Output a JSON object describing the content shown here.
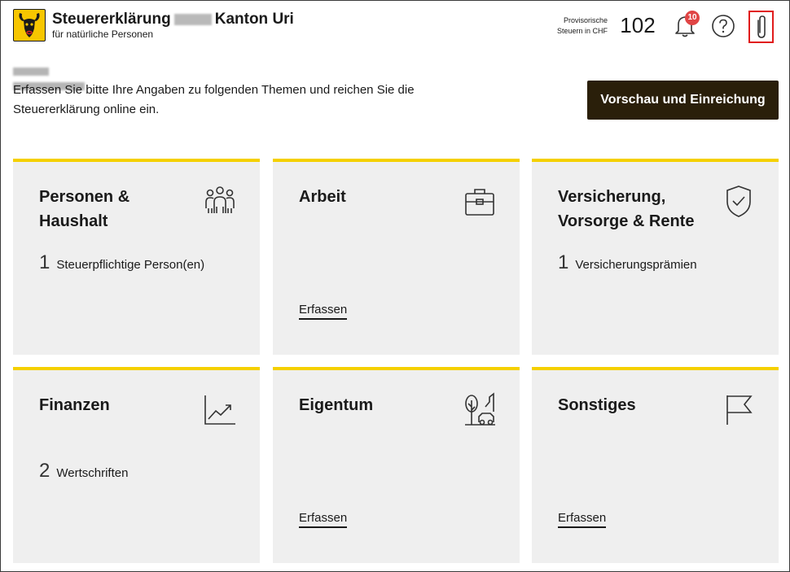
{
  "header": {
    "title_part1": "Steuererklärung",
    "title_part2": "Kanton Uri",
    "subtitle": "für natürliche Personen",
    "tax_label_line1": "Provisorische",
    "tax_label_line2": "Steuern in CHF",
    "tax_amount": "102",
    "notification_count": "10"
  },
  "intro": {
    "text": "Erfassen Sie bitte Ihre Angaben zu folgenden Themen und reichen Sie die Steuererklärung online ein.",
    "submit_label": "Vorschau und Einreichung"
  },
  "cards": [
    {
      "title": "Personen & Haushalt",
      "count": "1",
      "count_label": "Steuerpflichtige Person(en)",
      "icon": "people-icon"
    },
    {
      "title": "Arbeit",
      "action": "Erfassen",
      "icon": "briefcase-icon"
    },
    {
      "title": "Versicherung, Vorsorge & Rente",
      "count": "1",
      "count_label": "Versicherungsprämien",
      "icon": "shield-icon"
    },
    {
      "title": "Finanzen",
      "count": "2",
      "count_label": "Wertschriften",
      "icon": "chart-icon"
    },
    {
      "title": "Eigentum",
      "action": "Erfassen",
      "icon": "property-icon"
    },
    {
      "title": "Sonstiges",
      "action": "Erfassen",
      "icon": "flag-icon"
    }
  ],
  "colors": {
    "accent": "#f5d000",
    "button_bg": "#2a1f0a",
    "card_bg": "#efefef",
    "badge": "#e04545",
    "highlight": "#e01b1b"
  }
}
